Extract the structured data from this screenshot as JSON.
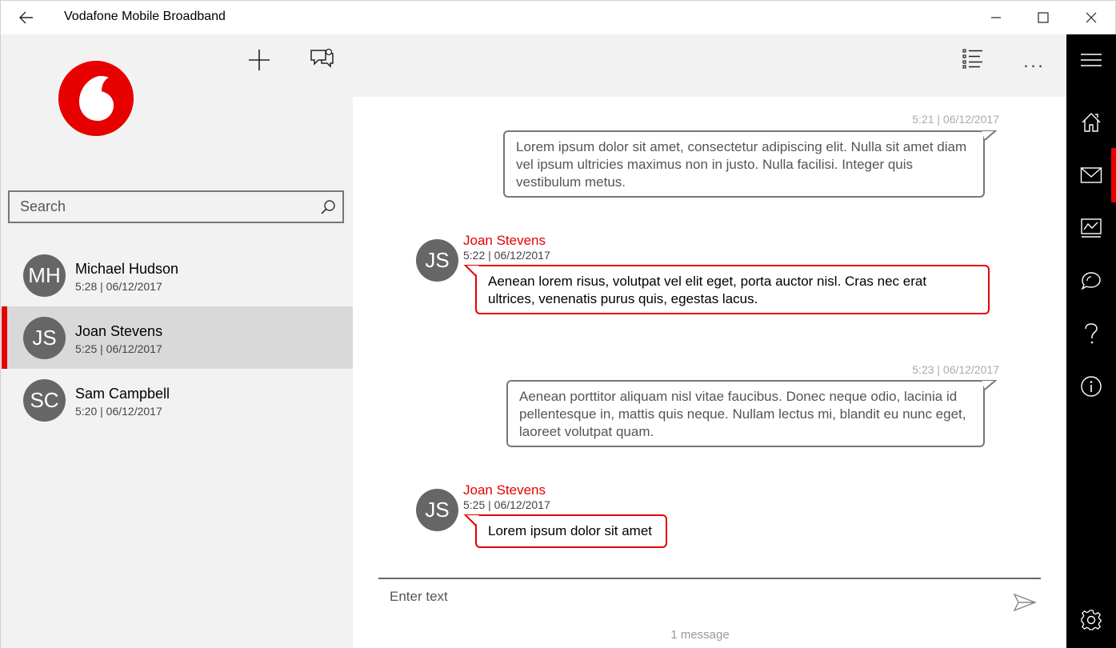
{
  "window": {
    "title": "Vodafone Mobile Broadband",
    "back_icon": "back-arrow-icon",
    "minimize_icon": "minimize-icon",
    "maximize_icon": "maximize-icon",
    "close_icon": "close-icon"
  },
  "brand": {
    "accent": "#e60000",
    "logo": "vodafone-logo"
  },
  "toolbar": {
    "new_message_icon": "plus-icon",
    "chat_settings_icon": "chat-settings-icon",
    "select_icon": "list-select-icon",
    "more_icon": "more-icon",
    "more_label": "..."
  },
  "search": {
    "placeholder": "Search",
    "value": ""
  },
  "contacts": [
    {
      "initials": "MH",
      "name": "Michael Hudson",
      "time": "5:28 | 06/12/2017",
      "selected": false
    },
    {
      "initials": "JS",
      "name": "Joan Stevens",
      "time": "5:25 | 06/12/2017",
      "selected": true
    },
    {
      "initials": "SC",
      "name": "Sam Campbell",
      "time": "5:20 | 06/12/2017",
      "selected": false
    }
  ],
  "messages": [
    {
      "direction": "out",
      "time": "5:21 | 06/12/2017",
      "text": "Lorem ipsum dolor sit amet, consectetur adipiscing elit. Nulla sit amet diam vel ipsum ultricies maximus non in justo. Nulla facilisi. Integer quis vestibulum metus."
    },
    {
      "direction": "in",
      "sender": "Joan Stevens",
      "initials": "JS",
      "time": "5:22 | 06/12/2017",
      "text": "Aenean lorem risus, volutpat vel elit eget, porta auctor nisl. Cras nec erat ultrices, venenatis purus quis, egestas lacus."
    },
    {
      "direction": "out",
      "time": "5:23 | 06/12/2017",
      "text": "Aenean porttitor aliquam nisl vitae faucibus. Donec neque odio, lacinia id pellentesque in, mattis quis neque. Nullam lectus mi, blandit eu nunc eget, laoreet volutpat quam."
    },
    {
      "direction": "in",
      "sender": "Joan Stevens",
      "initials": "JS",
      "time": "5:25 | 06/12/2017",
      "text": "Lorem ipsum dolor sit amet"
    }
  ],
  "compose": {
    "placeholder": "Enter text",
    "value": "",
    "send_icon": "send-icon",
    "count_label": "1 message"
  },
  "nav": {
    "menu_icon": "hamburger-menu-icon",
    "items": [
      "home-icon",
      "mail-icon",
      "usage-icon",
      "chat-icon",
      "help-icon",
      "info-icon"
    ],
    "active": "mail-icon",
    "settings_icon": "gear-icon"
  }
}
